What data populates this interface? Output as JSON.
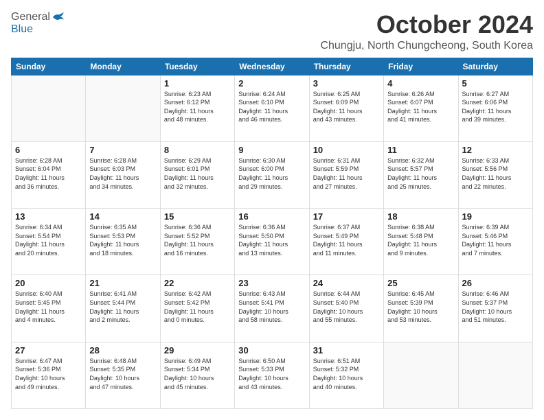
{
  "header": {
    "logo_general": "General",
    "logo_blue": "Blue",
    "month": "October 2024",
    "location": "Chungju, North Chungcheong, South Korea"
  },
  "weekdays": [
    "Sunday",
    "Monday",
    "Tuesday",
    "Wednesday",
    "Thursday",
    "Friday",
    "Saturday"
  ],
  "weeks": [
    [
      {
        "day": "",
        "info": ""
      },
      {
        "day": "",
        "info": ""
      },
      {
        "day": "1",
        "info": "Sunrise: 6:23 AM\nSunset: 6:12 PM\nDaylight: 11 hours\nand 48 minutes."
      },
      {
        "day": "2",
        "info": "Sunrise: 6:24 AM\nSunset: 6:10 PM\nDaylight: 11 hours\nand 46 minutes."
      },
      {
        "day": "3",
        "info": "Sunrise: 6:25 AM\nSunset: 6:09 PM\nDaylight: 11 hours\nand 43 minutes."
      },
      {
        "day": "4",
        "info": "Sunrise: 6:26 AM\nSunset: 6:07 PM\nDaylight: 11 hours\nand 41 minutes."
      },
      {
        "day": "5",
        "info": "Sunrise: 6:27 AM\nSunset: 6:06 PM\nDaylight: 11 hours\nand 39 minutes."
      }
    ],
    [
      {
        "day": "6",
        "info": "Sunrise: 6:28 AM\nSunset: 6:04 PM\nDaylight: 11 hours\nand 36 minutes."
      },
      {
        "day": "7",
        "info": "Sunrise: 6:28 AM\nSunset: 6:03 PM\nDaylight: 11 hours\nand 34 minutes."
      },
      {
        "day": "8",
        "info": "Sunrise: 6:29 AM\nSunset: 6:01 PM\nDaylight: 11 hours\nand 32 minutes."
      },
      {
        "day": "9",
        "info": "Sunrise: 6:30 AM\nSunset: 6:00 PM\nDaylight: 11 hours\nand 29 minutes."
      },
      {
        "day": "10",
        "info": "Sunrise: 6:31 AM\nSunset: 5:59 PM\nDaylight: 11 hours\nand 27 minutes."
      },
      {
        "day": "11",
        "info": "Sunrise: 6:32 AM\nSunset: 5:57 PM\nDaylight: 11 hours\nand 25 minutes."
      },
      {
        "day": "12",
        "info": "Sunrise: 6:33 AM\nSunset: 5:56 PM\nDaylight: 11 hours\nand 22 minutes."
      }
    ],
    [
      {
        "day": "13",
        "info": "Sunrise: 6:34 AM\nSunset: 5:54 PM\nDaylight: 11 hours\nand 20 minutes."
      },
      {
        "day": "14",
        "info": "Sunrise: 6:35 AM\nSunset: 5:53 PM\nDaylight: 11 hours\nand 18 minutes."
      },
      {
        "day": "15",
        "info": "Sunrise: 6:36 AM\nSunset: 5:52 PM\nDaylight: 11 hours\nand 16 minutes."
      },
      {
        "day": "16",
        "info": "Sunrise: 6:36 AM\nSunset: 5:50 PM\nDaylight: 11 hours\nand 13 minutes."
      },
      {
        "day": "17",
        "info": "Sunrise: 6:37 AM\nSunset: 5:49 PM\nDaylight: 11 hours\nand 11 minutes."
      },
      {
        "day": "18",
        "info": "Sunrise: 6:38 AM\nSunset: 5:48 PM\nDaylight: 11 hours\nand 9 minutes."
      },
      {
        "day": "19",
        "info": "Sunrise: 6:39 AM\nSunset: 5:46 PM\nDaylight: 11 hours\nand 7 minutes."
      }
    ],
    [
      {
        "day": "20",
        "info": "Sunrise: 6:40 AM\nSunset: 5:45 PM\nDaylight: 11 hours\nand 4 minutes."
      },
      {
        "day": "21",
        "info": "Sunrise: 6:41 AM\nSunset: 5:44 PM\nDaylight: 11 hours\nand 2 minutes."
      },
      {
        "day": "22",
        "info": "Sunrise: 6:42 AM\nSunset: 5:42 PM\nDaylight: 11 hours\nand 0 minutes."
      },
      {
        "day": "23",
        "info": "Sunrise: 6:43 AM\nSunset: 5:41 PM\nDaylight: 10 hours\nand 58 minutes."
      },
      {
        "day": "24",
        "info": "Sunrise: 6:44 AM\nSunset: 5:40 PM\nDaylight: 10 hours\nand 55 minutes."
      },
      {
        "day": "25",
        "info": "Sunrise: 6:45 AM\nSunset: 5:39 PM\nDaylight: 10 hours\nand 53 minutes."
      },
      {
        "day": "26",
        "info": "Sunrise: 6:46 AM\nSunset: 5:37 PM\nDaylight: 10 hours\nand 51 minutes."
      }
    ],
    [
      {
        "day": "27",
        "info": "Sunrise: 6:47 AM\nSunset: 5:36 PM\nDaylight: 10 hours\nand 49 minutes."
      },
      {
        "day": "28",
        "info": "Sunrise: 6:48 AM\nSunset: 5:35 PM\nDaylight: 10 hours\nand 47 minutes."
      },
      {
        "day": "29",
        "info": "Sunrise: 6:49 AM\nSunset: 5:34 PM\nDaylight: 10 hours\nand 45 minutes."
      },
      {
        "day": "30",
        "info": "Sunrise: 6:50 AM\nSunset: 5:33 PM\nDaylight: 10 hours\nand 43 minutes."
      },
      {
        "day": "31",
        "info": "Sunrise: 6:51 AM\nSunset: 5:32 PM\nDaylight: 10 hours\nand 40 minutes."
      },
      {
        "day": "",
        "info": ""
      },
      {
        "day": "",
        "info": ""
      }
    ]
  ]
}
